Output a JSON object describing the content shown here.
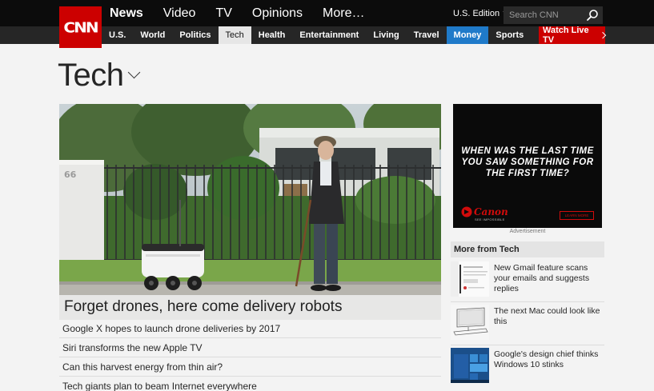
{
  "logo": {
    "text": "CNN"
  },
  "main_nav": [
    {
      "label": "News",
      "active": true
    },
    {
      "label": "Video",
      "active": false
    },
    {
      "label": "TV",
      "active": false
    },
    {
      "label": "Opinions",
      "active": false
    },
    {
      "label": "More…",
      "active": false
    }
  ],
  "edition": {
    "label": "U.S. Edition"
  },
  "search": {
    "placeholder": "Search CNN"
  },
  "sub_nav": [
    {
      "label": "U.S."
    },
    {
      "label": "World"
    },
    {
      "label": "Politics"
    },
    {
      "label": "Tech"
    },
    {
      "label": "Health"
    },
    {
      "label": "Entertainment"
    },
    {
      "label": "Living"
    },
    {
      "label": "Travel"
    },
    {
      "label": "Money"
    },
    {
      "label": "Sports"
    }
  ],
  "watch_live": {
    "label": "Watch Live TV"
  },
  "page": {
    "title": "Tech"
  },
  "hero": {
    "caption": "Forget drones, here come delivery robots",
    "house_number": "66"
  },
  "headlines": [
    "Google X hopes to launch drone deliveries by 2017",
    "Siri transforms the new Apple TV",
    "Can this harvest energy from thin air?",
    "Tech giants plan to beam Internet everywhere"
  ],
  "ad": {
    "line1": "WHEN WAS THE LAST TIME",
    "line2": "YOU SAW SOMETHING FOR",
    "line3": "THE FIRST TIME?",
    "brand": "Canon",
    "tagline": "SEE IMPOSSIBLE",
    "cta": "LEARN MORE",
    "label": "Advertisement"
  },
  "more_from_tech": {
    "heading": "More from Tech",
    "stories": [
      {
        "title": "New Gmail feature scans your emails and suggests replies"
      },
      {
        "title": "The next Mac could look like this"
      },
      {
        "title": "Google's design chief thinks Windows 10 stinks"
      }
    ]
  },
  "colors": {
    "cnn_red": "#cc0000",
    "money_blue": "#1f7ac9",
    "nav_black": "#0c0c0c",
    "subnav_dark": "#262626",
    "page_bg": "#f3f3f3"
  }
}
